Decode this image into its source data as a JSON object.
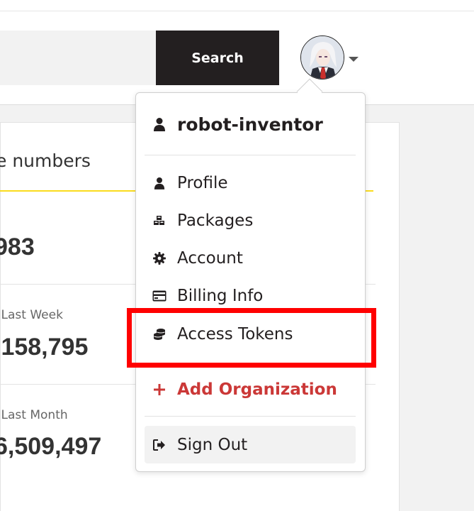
{
  "header": {
    "search_placeholder": "",
    "search_button_label": "Search"
  },
  "stats": {
    "title_partial": "e numbers",
    "total_value_partial": "983",
    "last_week_label_partial": "- Last Week",
    "last_week_value_partial": ",158,795",
    "last_month_label_partial": "- Last Month",
    "last_month_value_partial": "6,509,497"
  },
  "menu": {
    "username": "robot-inventor",
    "items": [
      {
        "label": "Profile",
        "icon": "user-icon"
      },
      {
        "label": "Packages",
        "icon": "cubes-icon"
      },
      {
        "label": "Account",
        "icon": "gear-icon"
      },
      {
        "label": "Billing Info",
        "icon": "credit-card-icon"
      },
      {
        "label": "Access Tokens",
        "icon": "coins-icon"
      }
    ],
    "add_org_label": "Add Organization",
    "sign_out_label": "Sign Out"
  },
  "colors": {
    "search_button_bg": "#231f20",
    "accent_red": "#cb3837",
    "highlight": "#ff0000",
    "yellow_rule": "#fadc1e"
  }
}
